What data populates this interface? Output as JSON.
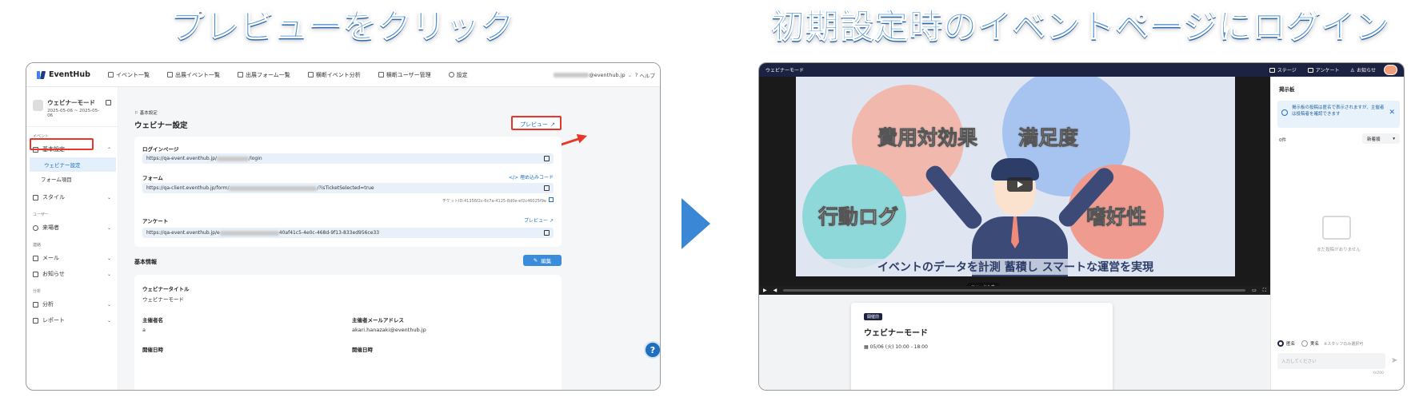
{
  "headings": {
    "left": "プレビューをクリック",
    "right": "初期設定時のイベントページにログイン"
  },
  "left_app": {
    "logo": "EventHub",
    "nav": [
      "イベント一覧",
      "出展イベント一覧",
      "出展フォーム一覧",
      "横断イベント分析",
      "横断ユーザー管理",
      "設定"
    ],
    "user_email_suffix": "@eventhub.jp",
    "help": "ヘルプ",
    "event": {
      "title": "ウェビナーモード",
      "dates": "2025-05-06 ~ 2025-05-06"
    },
    "sidebar": {
      "sec_event": "イベント",
      "basic": "基本設定",
      "webinar_settings": "ウェビナー設定",
      "form_items": "フォーム項目",
      "style": "スタイル",
      "sec_user": "ユーザー",
      "visitors": "来場者",
      "sec_comm": "連絡",
      "mail": "メール",
      "notice": "お知らせ",
      "sec_analysis": "分析",
      "analysis": "分析",
      "report": "レポート"
    },
    "breadcrumb": "基本設定",
    "page_title": "ウェビナー設定",
    "preview_label": "プレビュー",
    "login_page_label": "ログインページ",
    "login_url_pre": "https://qa-event.eventhub.jp/",
    "login_url_post": "/login",
    "form_label": "フォーム",
    "embed_code": "埋め込みコード",
    "form_url_pre": "https://qa-client.eventhub.jp/form/",
    "form_url_post": "/?isTicketSelected=true",
    "ticket_id": "チケットID:41356f2c-6c7a-4125-8d0e-ef2c46025f9e",
    "survey_label": "アンケート",
    "survey_preview": "プレビュー",
    "survey_url_pre": "https://qa-event.eventhub.jp/e",
    "survey_url_post": "40af41c5-4e0c-468d-9f13-833ed956ce33",
    "basic_info": "基本情報",
    "edit": "編集",
    "webinar_title_label": "ウェビナータイトル",
    "webinar_title_value": "ウェビナーモード",
    "organizer_label": "主催者名",
    "organizer_value": "a",
    "organizer_email_label": "主催者メールアドレス",
    "organizer_email_value": "akari.hanazaki@eventhub.jp",
    "date_label_1": "開催日時",
    "date_label_2": "開催日時"
  },
  "right_app": {
    "title": "ウェビナーモード",
    "nav": [
      "ステージ",
      "アンケート",
      "お知らせ"
    ],
    "video": {
      "bubbles": [
        "費用対効果",
        "満足度",
        "行動ログ",
        "嗜好性"
      ],
      "tagline": "イベントのデータを計測 蓄積し スマートな運営を実現",
      "rehearsal": "リハーサル中"
    },
    "event_card": {
      "badge": "開催前",
      "title": "ウェビナーモード",
      "date": "05/06 (火) 10:00 - 18:00"
    },
    "board": {
      "title": "掲示板",
      "info": "掲示板の投稿は匿名で表示されますが、主催者は投稿者を確認できます",
      "count": "0件",
      "sort": "新着順",
      "empty": "まだ投稿がありません",
      "anon": "匿名",
      "real": "実名",
      "staff_only": "※スタッフのみ選択可",
      "input_placeholder": "入力してください",
      "length": "0/200"
    }
  },
  "colors": {
    "heading": "#4a90d9",
    "accent_red": "#e8372a",
    "brand_blue": "#1f6fbf",
    "navy": "#1c2342",
    "arrow": "#3a87d6"
  }
}
